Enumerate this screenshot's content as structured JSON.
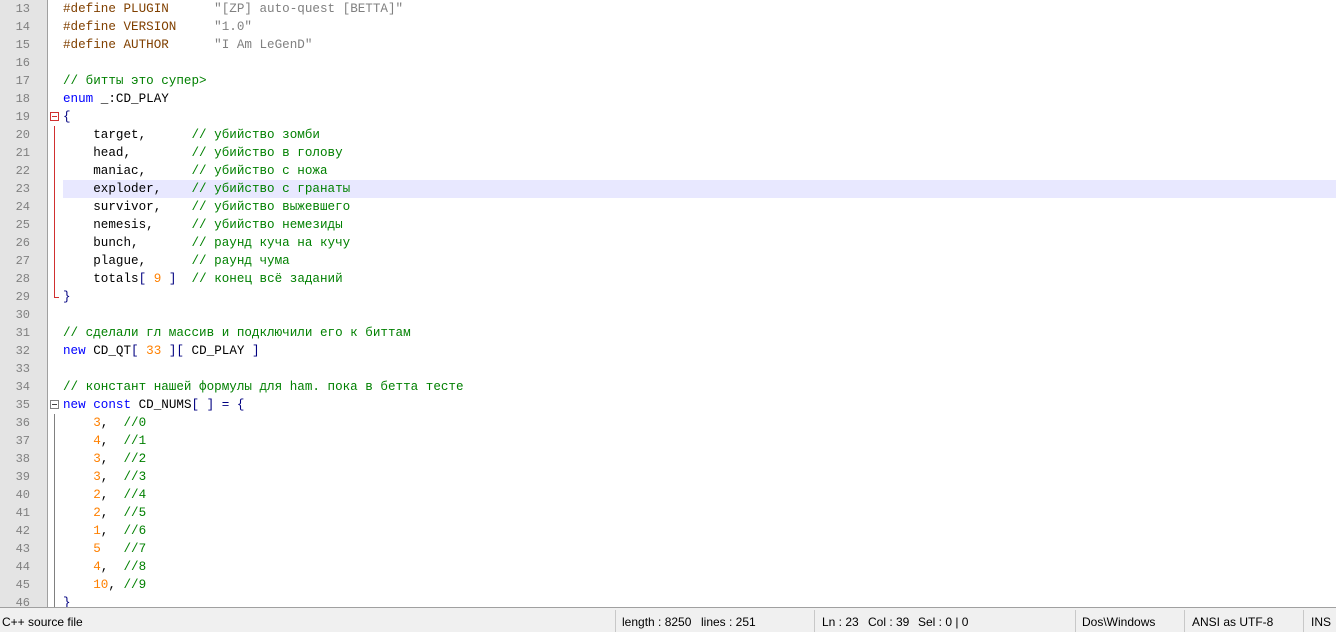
{
  "editor": {
    "current_line": 23,
    "lines": [
      {
        "n": "13",
        "fold": "",
        "tokens": [
          {
            "t": "#define PLUGIN      ",
            "c": "pre"
          },
          {
            "t": "\"[ZP] auto-quest [BETTA]\"",
            "c": "str"
          }
        ]
      },
      {
        "n": "14",
        "fold": "",
        "tokens": [
          {
            "t": "#define VERSION     ",
            "c": "pre"
          },
          {
            "t": "\"1.0\"",
            "c": "str"
          }
        ]
      },
      {
        "n": "15",
        "fold": "",
        "tokens": [
          {
            "t": "#define AUTHOR      ",
            "c": "pre"
          },
          {
            "t": "\"I Am LeGenD\"",
            "c": "str"
          }
        ]
      },
      {
        "n": "16",
        "fold": "",
        "tokens": []
      },
      {
        "n": "17",
        "fold": "",
        "tokens": [
          {
            "t": "// битты это супер>",
            "c": "com"
          }
        ]
      },
      {
        "n": "18",
        "fold": "",
        "tokens": [
          {
            "t": "enum",
            "c": "kw"
          },
          {
            "t": " _:CD_PLAY",
            "c": ""
          }
        ]
      },
      {
        "n": "19",
        "fold": "minus",
        "tokens": [
          {
            "t": "{",
            "c": "op"
          }
        ]
      },
      {
        "n": "20",
        "fold": "bar",
        "tokens": [
          {
            "t": "    target,      ",
            "c": ""
          },
          {
            "t": "// убийство зомби",
            "c": "com"
          }
        ]
      },
      {
        "n": "21",
        "fold": "bar",
        "tokens": [
          {
            "t": "    head,        ",
            "c": ""
          },
          {
            "t": "// убийство в голову",
            "c": "com"
          }
        ]
      },
      {
        "n": "22",
        "fold": "bar",
        "tokens": [
          {
            "t": "    maniac,      ",
            "c": ""
          },
          {
            "t": "// убийство с ножа",
            "c": "com"
          }
        ]
      },
      {
        "n": "23",
        "fold": "bar",
        "tokens": [
          {
            "t": "    exploder,    ",
            "c": ""
          },
          {
            "t": "// убийство с гранаты",
            "c": "com"
          }
        ]
      },
      {
        "n": "24",
        "fold": "bar",
        "tokens": [
          {
            "t": "    survivor,    ",
            "c": ""
          },
          {
            "t": "// убийство выжевшего",
            "c": "com"
          }
        ]
      },
      {
        "n": "25",
        "fold": "bar",
        "tokens": [
          {
            "t": "    nemesis,     ",
            "c": ""
          },
          {
            "t": "// убийство немезиды",
            "c": "com"
          }
        ]
      },
      {
        "n": "26",
        "fold": "bar",
        "tokens": [
          {
            "t": "    bunch,       ",
            "c": ""
          },
          {
            "t": "// раунд куча на кучу",
            "c": "com"
          }
        ]
      },
      {
        "n": "27",
        "fold": "bar",
        "tokens": [
          {
            "t": "    plague,      ",
            "c": ""
          },
          {
            "t": "// раунд чума",
            "c": "com"
          }
        ]
      },
      {
        "n": "28",
        "fold": "bar",
        "tokens": [
          {
            "t": "    totals",
            "c": ""
          },
          {
            "t": "[ ",
            "c": "op"
          },
          {
            "t": "9",
            "c": "num"
          },
          {
            "t": " ]",
            "c": "op"
          },
          {
            "t": "  ",
            "c": ""
          },
          {
            "t": "// конец всё заданий",
            "c": "com"
          }
        ]
      },
      {
        "n": "29",
        "fold": "end",
        "tokens": [
          {
            "t": "}",
            "c": "op"
          }
        ]
      },
      {
        "n": "30",
        "fold": "",
        "tokens": []
      },
      {
        "n": "31",
        "fold": "",
        "tokens": [
          {
            "t": "// сделали гл массив и подключили его к биттам",
            "c": "com"
          }
        ]
      },
      {
        "n": "32",
        "fold": "",
        "tokens": [
          {
            "t": "new",
            "c": "kw"
          },
          {
            "t": " CD_QT",
            "c": ""
          },
          {
            "t": "[ ",
            "c": "op"
          },
          {
            "t": "33",
            "c": "num"
          },
          {
            "t": " ][ ",
            "c": "op"
          },
          {
            "t": "CD_PLAY",
            "c": ""
          },
          {
            "t": " ]",
            "c": "op"
          }
        ]
      },
      {
        "n": "33",
        "fold": "",
        "tokens": []
      },
      {
        "n": "34",
        "fold": "",
        "tokens": [
          {
            "t": "// констант нашей формулы для ham. пока в бетта тесте",
            "c": "com"
          }
        ]
      },
      {
        "n": "35",
        "fold": "minus-dark",
        "tokens": [
          {
            "t": "new",
            "c": "kw"
          },
          {
            "t": " ",
            "c": ""
          },
          {
            "t": "const",
            "c": "kw"
          },
          {
            "t": " CD_NUMS",
            "c": ""
          },
          {
            "t": "[ ] = {",
            "c": "op"
          }
        ]
      },
      {
        "n": "36",
        "fold": "bar-grey",
        "tokens": [
          {
            "t": "    ",
            "c": ""
          },
          {
            "t": "3",
            "c": "num"
          },
          {
            "t": ",  ",
            "c": ""
          },
          {
            "t": "//0",
            "c": "com"
          }
        ]
      },
      {
        "n": "37",
        "fold": "bar-grey",
        "tokens": [
          {
            "t": "    ",
            "c": ""
          },
          {
            "t": "4",
            "c": "num"
          },
          {
            "t": ",  ",
            "c": ""
          },
          {
            "t": "//1",
            "c": "com"
          }
        ]
      },
      {
        "n": "38",
        "fold": "bar-grey",
        "tokens": [
          {
            "t": "    ",
            "c": ""
          },
          {
            "t": "3",
            "c": "num"
          },
          {
            "t": ",  ",
            "c": ""
          },
          {
            "t": "//2",
            "c": "com"
          }
        ]
      },
      {
        "n": "39",
        "fold": "bar-grey",
        "tokens": [
          {
            "t": "    ",
            "c": ""
          },
          {
            "t": "3",
            "c": "num"
          },
          {
            "t": ",  ",
            "c": ""
          },
          {
            "t": "//3",
            "c": "com"
          }
        ]
      },
      {
        "n": "40",
        "fold": "bar-grey",
        "tokens": [
          {
            "t": "    ",
            "c": ""
          },
          {
            "t": "2",
            "c": "num"
          },
          {
            "t": ",  ",
            "c": ""
          },
          {
            "t": "//4",
            "c": "com"
          }
        ]
      },
      {
        "n": "41",
        "fold": "bar-grey",
        "tokens": [
          {
            "t": "    ",
            "c": ""
          },
          {
            "t": "2",
            "c": "num"
          },
          {
            "t": ",  ",
            "c": ""
          },
          {
            "t": "//5",
            "c": "com"
          }
        ]
      },
      {
        "n": "42",
        "fold": "bar-grey",
        "tokens": [
          {
            "t": "    ",
            "c": ""
          },
          {
            "t": "1",
            "c": "num"
          },
          {
            "t": ",  ",
            "c": ""
          },
          {
            "t": "//6",
            "c": "com"
          }
        ]
      },
      {
        "n": "43",
        "fold": "bar-grey",
        "tokens": [
          {
            "t": "    ",
            "c": ""
          },
          {
            "t": "5",
            "c": "num"
          },
          {
            "t": "   ",
            "c": ""
          },
          {
            "t": "//7",
            "c": "com"
          }
        ]
      },
      {
        "n": "44",
        "fold": "bar-grey",
        "tokens": [
          {
            "t": "    ",
            "c": ""
          },
          {
            "t": "4",
            "c": "num"
          },
          {
            "t": ",  ",
            "c": ""
          },
          {
            "t": "//8",
            "c": "com"
          }
        ]
      },
      {
        "n": "45",
        "fold": "bar-grey",
        "tokens": [
          {
            "t": "    ",
            "c": ""
          },
          {
            "t": "10",
            "c": "num"
          },
          {
            "t": ", ",
            "c": ""
          },
          {
            "t": "//9",
            "c": "com"
          }
        ]
      },
      {
        "n": "46",
        "fold": "end-grey",
        "tokens": [
          {
            "t": "}",
            "c": "op"
          }
        ]
      }
    ]
  },
  "statusbar": {
    "file_type": "C++ source file",
    "length": "length : 8250",
    "lines": "lines : 251",
    "ln": "Ln : 23",
    "col": "Col : 39",
    "sel": "Sel : 0 | 0",
    "eol": "Dos\\Windows",
    "encoding": "ANSI as UTF-8",
    "mode": "INS"
  }
}
